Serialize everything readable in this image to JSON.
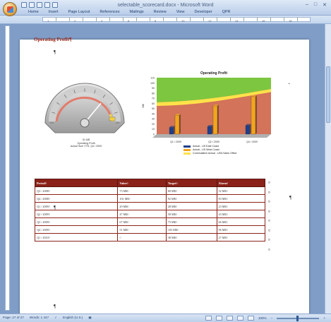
{
  "window": {
    "title": "selectable_scorecard.docx - Microsoft Word",
    "tabs": [
      "Home",
      "Insert",
      "Page Layout",
      "References",
      "Mailings",
      "Review",
      "View",
      "Developer",
      "QPR"
    ]
  },
  "ruler": {
    "marks": [
      "1",
      "2",
      "4",
      "6",
      "8",
      "10",
      "12",
      "14",
      "16",
      "18"
    ]
  },
  "document": {
    "heading": "Operating Profit¶",
    "pilcrow": "¶",
    "gauge": {
      "value_label": "51 M$",
      "title": "Operating Profit",
      "subtitle": "Actual Sum YTD, Q4 / 2009",
      "level": 0.72
    },
    "table": {
      "headers": [
        "Period¤",
        "Value¤",
        "Target¤",
        "Alarm¤"
      ],
      "rows": [
        [
          "Q3 / 2008¤",
          "73 M$¤",
          "69 M$¤",
          "52 M$¤"
        ],
        [
          "Q4 / 2008¤",
          "101 M$¤",
          "92 M$¤",
          "83 M$¤"
        ],
        [
          "Q1 / 2009¤",
          "29 M$¤",
          "28 M$¤",
          "23 M$¤"
        ],
        [
          "Q2 / 2009¤",
          "47 M$¤",
          "50 M$¤",
          "43 M$¤"
        ],
        [
          "Q3 / 2009¤",
          "67 M$¤",
          "73 M$¤",
          "66 M$¤"
        ],
        [
          "Q4 / 2009¤",
          "51 M$¤",
          "103 M$¤",
          "96 M$¤"
        ],
        [
          "Q1 / 2010¤",
          "¤",
          "38 M$¤",
          "27 M$¤"
        ]
      ],
      "row_end_mark": "¤"
    }
  },
  "chart_data": {
    "type": "bar",
    "title": "Operating Profit",
    "ylabel": "M$",
    "categories": [
      "Q1 / 2009",
      "Q2 / 2009",
      "Q4 / 2009"
    ],
    "ylim": [
      0,
      110
    ],
    "yticks": [
      "0",
      "10",
      "20",
      "30",
      "40",
      "50",
      "60",
      "70",
      "80",
      "90",
      "100",
      "110"
    ],
    "series": [
      {
        "name": "Actual - US East Coast",
        "values": [
          13,
          15,
          17
        ],
        "color": "#1f3f8a"
      },
      {
        "name": "Actual - US West Coast",
        "values": [
          37,
          55,
          73
        ],
        "color": "#f2a51c"
      }
    ],
    "background_band": {
      "name": "Cummulative Actual - USA Sales Office",
      "color": "#ffe14a"
    },
    "band_colors": {
      "top": "#7dc63f",
      "bottom": "#d2735a"
    }
  },
  "statusbar": {
    "page": "Page: 27 of 27",
    "words": "Words: 1 447",
    "language": "English (U.S.)",
    "zoom": "100%"
  }
}
